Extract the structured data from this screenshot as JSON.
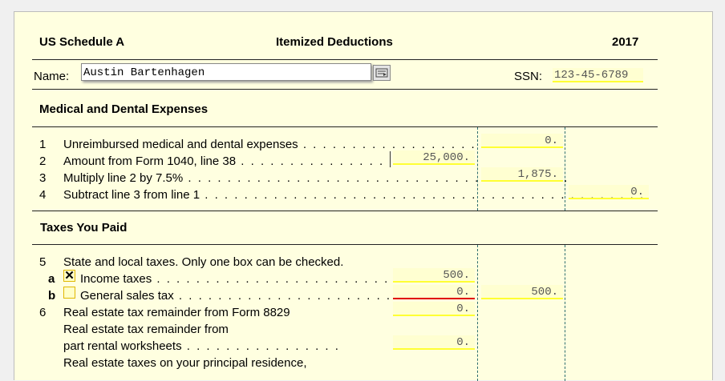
{
  "header": {
    "form": "US Schedule A",
    "title": "Itemized Deductions",
    "year": "2017"
  },
  "name_row": {
    "name_label": "Name:",
    "name_value": "Austin Bartenhagen",
    "ssn_label": "SSN:",
    "ssn_value": "123-45-6789"
  },
  "medical": {
    "title": "Medical and Dental Expenses",
    "lines": [
      {
        "num": "1",
        "label": "Unreimbursed medical and dental expenses",
        "value": "0."
      },
      {
        "num": "2",
        "label": "Amount from Form 1040,  line 38",
        "value": "25,000."
      },
      {
        "num": "3",
        "label": "Multiply line 2 by 7.5%",
        "value": "1,875."
      },
      {
        "num": "4",
        "label": "Subtract line 3 from line 1",
        "value": "0."
      }
    ]
  },
  "taxes": {
    "title": "Taxes You Paid",
    "line5": {
      "num": "5",
      "label": "State and local taxes.  Only one box can be checked."
    },
    "line5a": {
      "num": "a",
      "mark": "✕",
      "label": "Income taxes",
      "value": "500."
    },
    "line5b": {
      "num": "b",
      "label": "General sales tax",
      "value": "0.",
      "total": "500."
    },
    "line6": {
      "num": "6",
      "label": "Real estate tax remainder from Form 8829",
      "value": "0."
    },
    "line6b": {
      "label1": "Real estate tax remainder from",
      "label2": "part rental worksheets",
      "value": "0."
    },
    "line6c": {
      "label": "Real estate taxes on your principal residence,"
    }
  },
  "colors": {
    "form_bg": "#ffffe0",
    "field_underline": "#ffff33",
    "error_underline": "#e00000"
  }
}
